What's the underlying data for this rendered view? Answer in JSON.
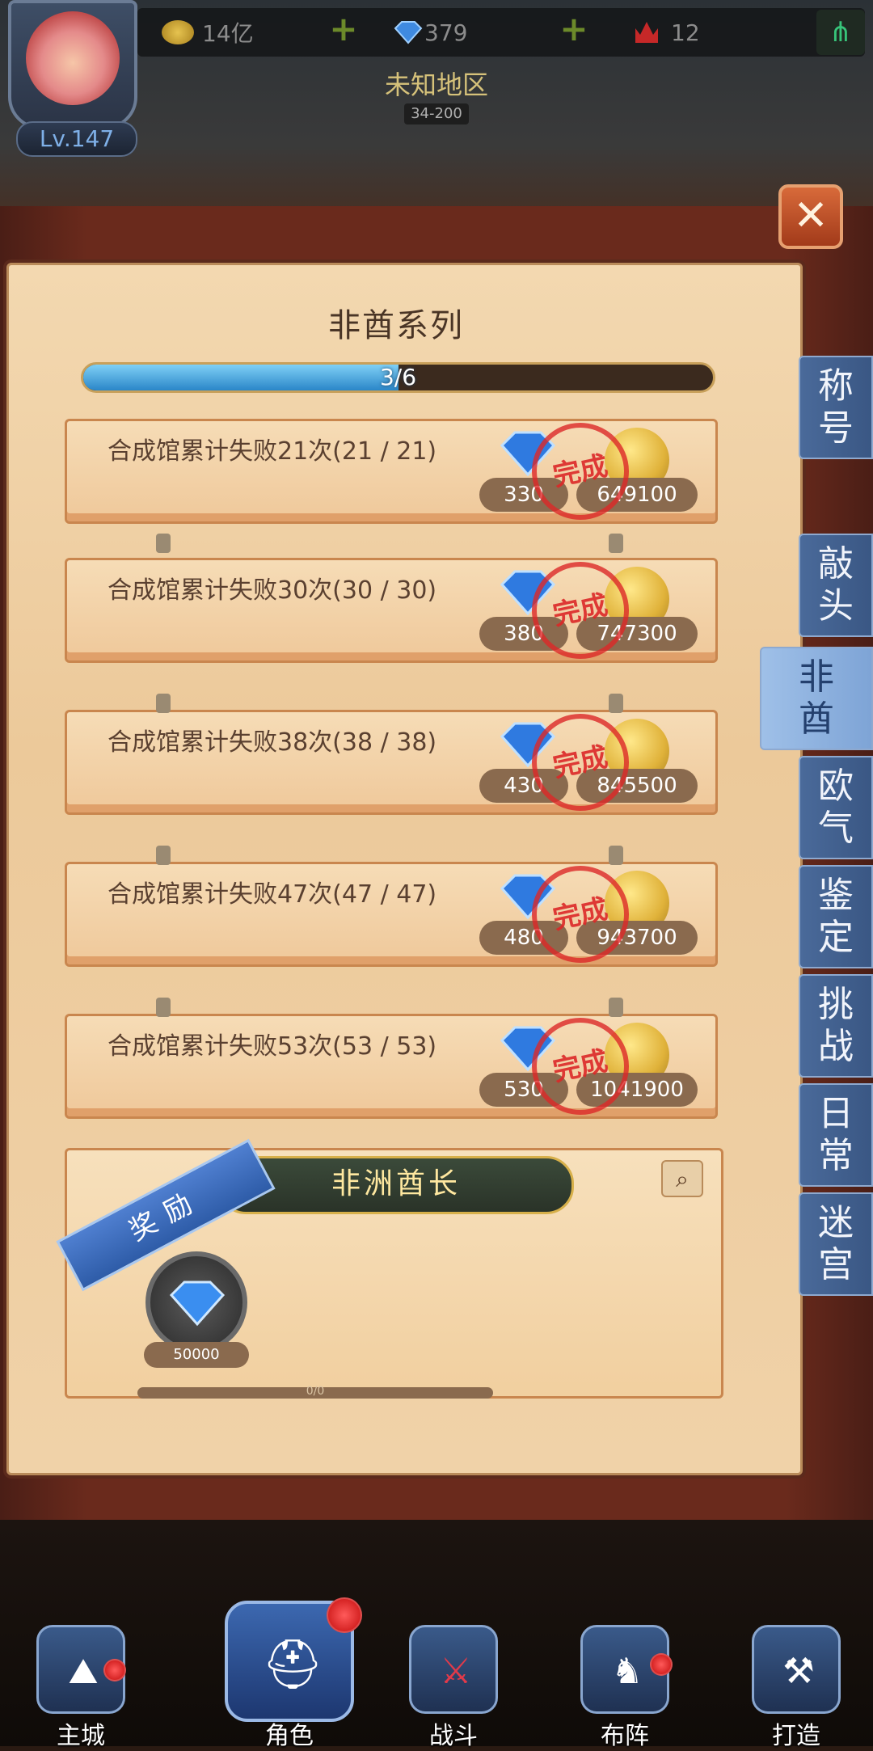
{
  "hud": {
    "level": "Lv.147",
    "coins": "14亿",
    "gems": "379",
    "tickets": "12",
    "region_title": "未知地区",
    "region_range": "34-200"
  },
  "panel": {
    "title": "非酋系列",
    "progress_text": "3/6",
    "progress_fraction": 0.5,
    "close_label": "✕"
  },
  "achievements": [
    {
      "label": "合成馆累计失败21次(21 / 21)",
      "gem_reward": "330",
      "coin_reward": "649100",
      "status": "完成"
    },
    {
      "label": "合成馆累计失败30次(30 / 30)",
      "gem_reward": "380",
      "coin_reward": "747300",
      "status": "完成"
    },
    {
      "label": "合成馆累计失败38次(38 / 38)",
      "gem_reward": "430",
      "coin_reward": "845500",
      "status": "完成"
    },
    {
      "label": "合成馆累计失败47次(47 / 47)",
      "gem_reward": "480",
      "coin_reward": "943700",
      "status": "完成"
    },
    {
      "label": "合成馆累计失败53次(53 / 53)",
      "gem_reward": "530",
      "coin_reward": "1041900",
      "status": "完成"
    }
  ],
  "reward": {
    "ribbon": "奖励",
    "banner": "非洲酋长",
    "item_qty": "50000",
    "scroll_text": "0/0"
  },
  "side_tabs": [
    {
      "label": "称号",
      "active": false
    },
    {
      "label": "敲头",
      "active": false
    },
    {
      "label": "非酋",
      "active": true
    },
    {
      "label": "欧气",
      "active": false
    },
    {
      "label": "鉴定",
      "active": false
    },
    {
      "label": "挑战",
      "active": false
    },
    {
      "label": "日常",
      "active": false
    },
    {
      "label": "迷宫",
      "active": false
    }
  ],
  "nav": {
    "main_city": "主城",
    "character": "角色",
    "battle": "战斗",
    "formation": "布阵",
    "forge": "打造"
  },
  "colors": {
    "parchment": "#f3d8b0",
    "tab_blue": "#4a6a9a",
    "stamp_red": "#dc2828",
    "progress_blue": "#2a86c8"
  }
}
